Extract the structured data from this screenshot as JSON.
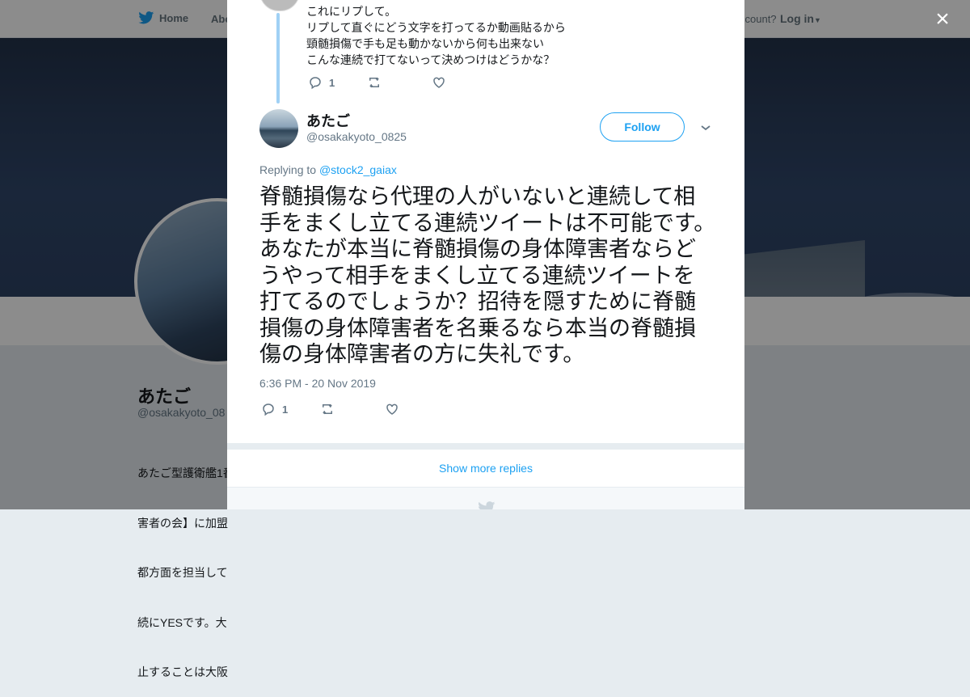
{
  "background": {
    "nav": {
      "home_label": "Home",
      "about_label": "Abo",
      "account_question": "ccount?",
      "login_label": "Log in"
    },
    "profile": {
      "name": "あたご",
      "handle": "@osakakyoto_08",
      "bio_lines": [
        "あたご型護衛艦1番",
        "害者の会】に加盟",
        "都方面を担当して",
        "続にYESです。大",
        "止することは大阪"
      ]
    }
  },
  "modal": {
    "close_label": "×",
    "previous_tweet": {
      "lines": [
        "これにリプして。",
        "リプして直ぐにどう文字を打ってるか動画貼るから",
        "頸髄損傷で手も足も動かないから何も出来ない",
        "こんな連続で打てないって決めつけはどうかな？"
      ],
      "reply_count": "1"
    },
    "tweet": {
      "name": "あたご",
      "handle": "@osakakyoto_0825",
      "follow_label": "Follow",
      "replying_to_prefix": "Replying to",
      "replying_to_mention": "@stock2_gaiax",
      "text": "脊髄損傷なら代理の人がいないと連続して相手をまくし立てる連続ツイートは不可能です。あなたが本当に脊髄損傷の身体障害者ならどうやって相手をまくし立てる連続ツイートを打てるのでしょうか？招待を隠すために脊髄損傷の身体障害者を名乗るなら本当の脊髄損傷の身体障害者の方に失礼です。",
      "timestamp": "6:36 PM - 20 Nov 2019",
      "reply_count": "1"
    },
    "show_more_label": "Show more replies"
  },
  "colors": {
    "accent": "#1da1f2",
    "thread_line": "#a0d1f5",
    "muted": "#657786"
  }
}
